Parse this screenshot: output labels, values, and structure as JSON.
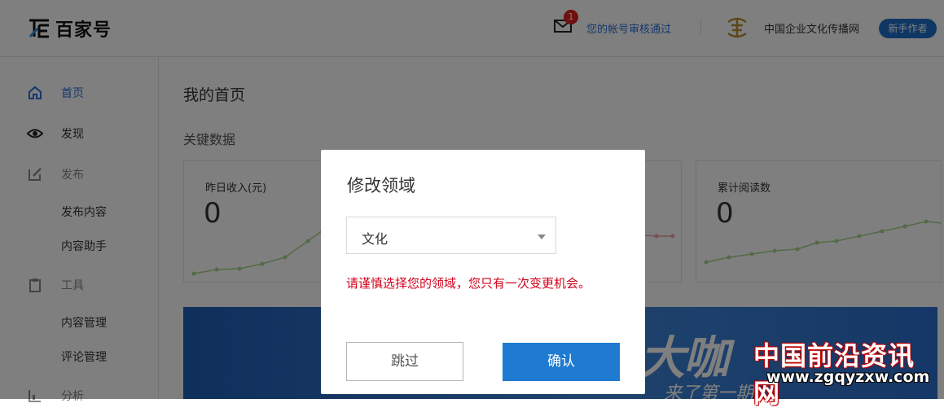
{
  "header": {
    "logo_text": "百家号",
    "mail_badge": "1",
    "notice": "您的帐号审核通过",
    "company": "中国企业文化传播网",
    "author_tag": "新手作者"
  },
  "sidebar": {
    "items": [
      {
        "label": "首页",
        "icon": "home-icon"
      },
      {
        "label": "发现",
        "icon": "eye-icon"
      },
      {
        "label": "发布",
        "icon": "edit-icon"
      },
      {
        "label": "发布内容"
      },
      {
        "label": "内容助手"
      },
      {
        "label": "工具",
        "icon": "clipboard-icon"
      },
      {
        "label": "内容管理"
      },
      {
        "label": "评论管理"
      },
      {
        "label": "分析",
        "icon": "chart-icon"
      }
    ]
  },
  "main": {
    "page_title": "我的首页",
    "section_title": "关键数据",
    "cards": [
      {
        "label": "昨日收入(元)",
        "value": "0"
      },
      {
        "label": "累计阅读数",
        "value": "0"
      }
    ],
    "banner_big": "大咖",
    "banner_sub": "来了第一期"
  },
  "modal": {
    "title": "修改领域",
    "select_value": "文化",
    "warning": "请谨慎选择您的领域，您只有一次变更机会。",
    "skip_label": "跳过",
    "confirm_label": "确认"
  },
  "watermark": {
    "cn": "中国前沿资讯网",
    "url": "www.zgqyzxw.com"
  },
  "colors": {
    "accent": "#1f7bd1",
    "link": "#2a6fd6",
    "warning": "#d0021b",
    "tag": "#1f6fc9"
  }
}
